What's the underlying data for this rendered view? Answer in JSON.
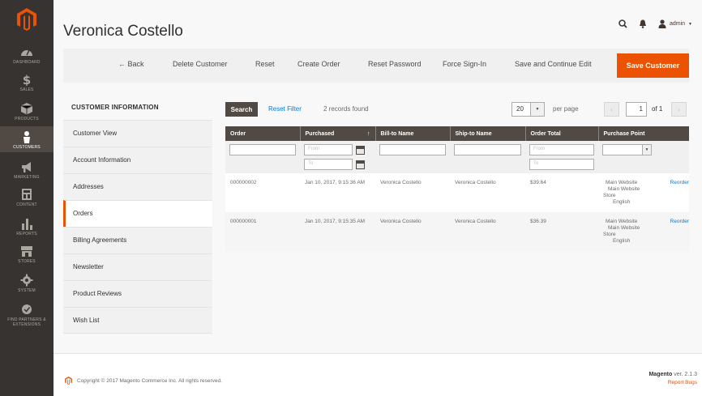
{
  "nav": {
    "items": [
      {
        "label": "DASHBOARD",
        "icon": "dashboard-icon"
      },
      {
        "label": "SALES",
        "icon": "dollar-icon"
      },
      {
        "label": "PRODUCTS",
        "icon": "cube-icon"
      },
      {
        "label": "CUSTOMERS",
        "icon": "person-icon"
      },
      {
        "label": "MARKETING",
        "icon": "megaphone-icon"
      },
      {
        "label": "CONTENT",
        "icon": "layout-icon"
      },
      {
        "label": "REPORTS",
        "icon": "bar-chart-icon"
      },
      {
        "label": "STORES",
        "icon": "store-icon"
      },
      {
        "label": "SYSTEM",
        "icon": "gear-icon"
      },
      {
        "label": "FIND PARTNERS & EXTENSIONS",
        "icon": "partners-icon"
      }
    ]
  },
  "header": {
    "title": "Veronica Costello",
    "user": "admin"
  },
  "actions": {
    "back": "← Back",
    "delete": "Delete Customer",
    "reset": "Reset",
    "create_order": "Create Order",
    "reset_password": "Reset Password",
    "force_signin": "Force Sign-In",
    "save_continue": "Save and Continue Edit",
    "save": "Save Customer"
  },
  "sidebar": {
    "title": "CUSTOMER INFORMATION",
    "items": [
      {
        "label": "Customer View"
      },
      {
        "label": "Account Information"
      },
      {
        "label": "Addresses"
      },
      {
        "label": "Orders"
      },
      {
        "label": "Billing Agreements"
      },
      {
        "label": "Newsletter"
      },
      {
        "label": "Product Reviews"
      },
      {
        "label": "Wish List"
      }
    ]
  },
  "grid": {
    "search_label": "Search",
    "reset_filter": "Reset Filter",
    "records": "2 records found",
    "per_page_value": "20",
    "per_page_label": "per page",
    "page_current": "1",
    "page_of": "of 1",
    "columns": [
      "Order",
      "Purchased",
      "Bill-to Name",
      "Ship-to Name",
      "Order Total",
      "Purchase Point"
    ],
    "filters": {
      "purchased_from": "From",
      "purchased_to": "To",
      "total_from": "From",
      "total_to": "To"
    },
    "rows": [
      {
        "order": "000000002",
        "purchased": "Jan 10, 2017, 9:15:36 AM",
        "bill_to": "Veronica Costello",
        "ship_to": "Veronica Costello",
        "total": "$39.64",
        "pp_line1": "Main Website",
        "pp_line2": "Main Website",
        "pp_line3": "Store",
        "pp_line4": "English",
        "action": "Reorder"
      },
      {
        "order": "000000001",
        "purchased": "Jan 10, 2017, 9:15:35 AM",
        "bill_to": "Veronica Costello",
        "ship_to": "Veronica Costello",
        "total": "$36.39",
        "pp_line1": "Main Website",
        "pp_line2": "Main Website",
        "pp_line3": "Store",
        "pp_line4": "English",
        "action": "Reorder"
      }
    ]
  },
  "footer": {
    "copyright": "Copyright © 2017 Magento Commerce Inc. All rights reserved.",
    "brand": "Magento",
    "version": "ver. 2.1.3",
    "report": "Report Bugs"
  },
  "colors": {
    "accent": "#eb5202",
    "nav_bg": "#373330",
    "header_bg": "#514943",
    "link": "#007bdb"
  }
}
